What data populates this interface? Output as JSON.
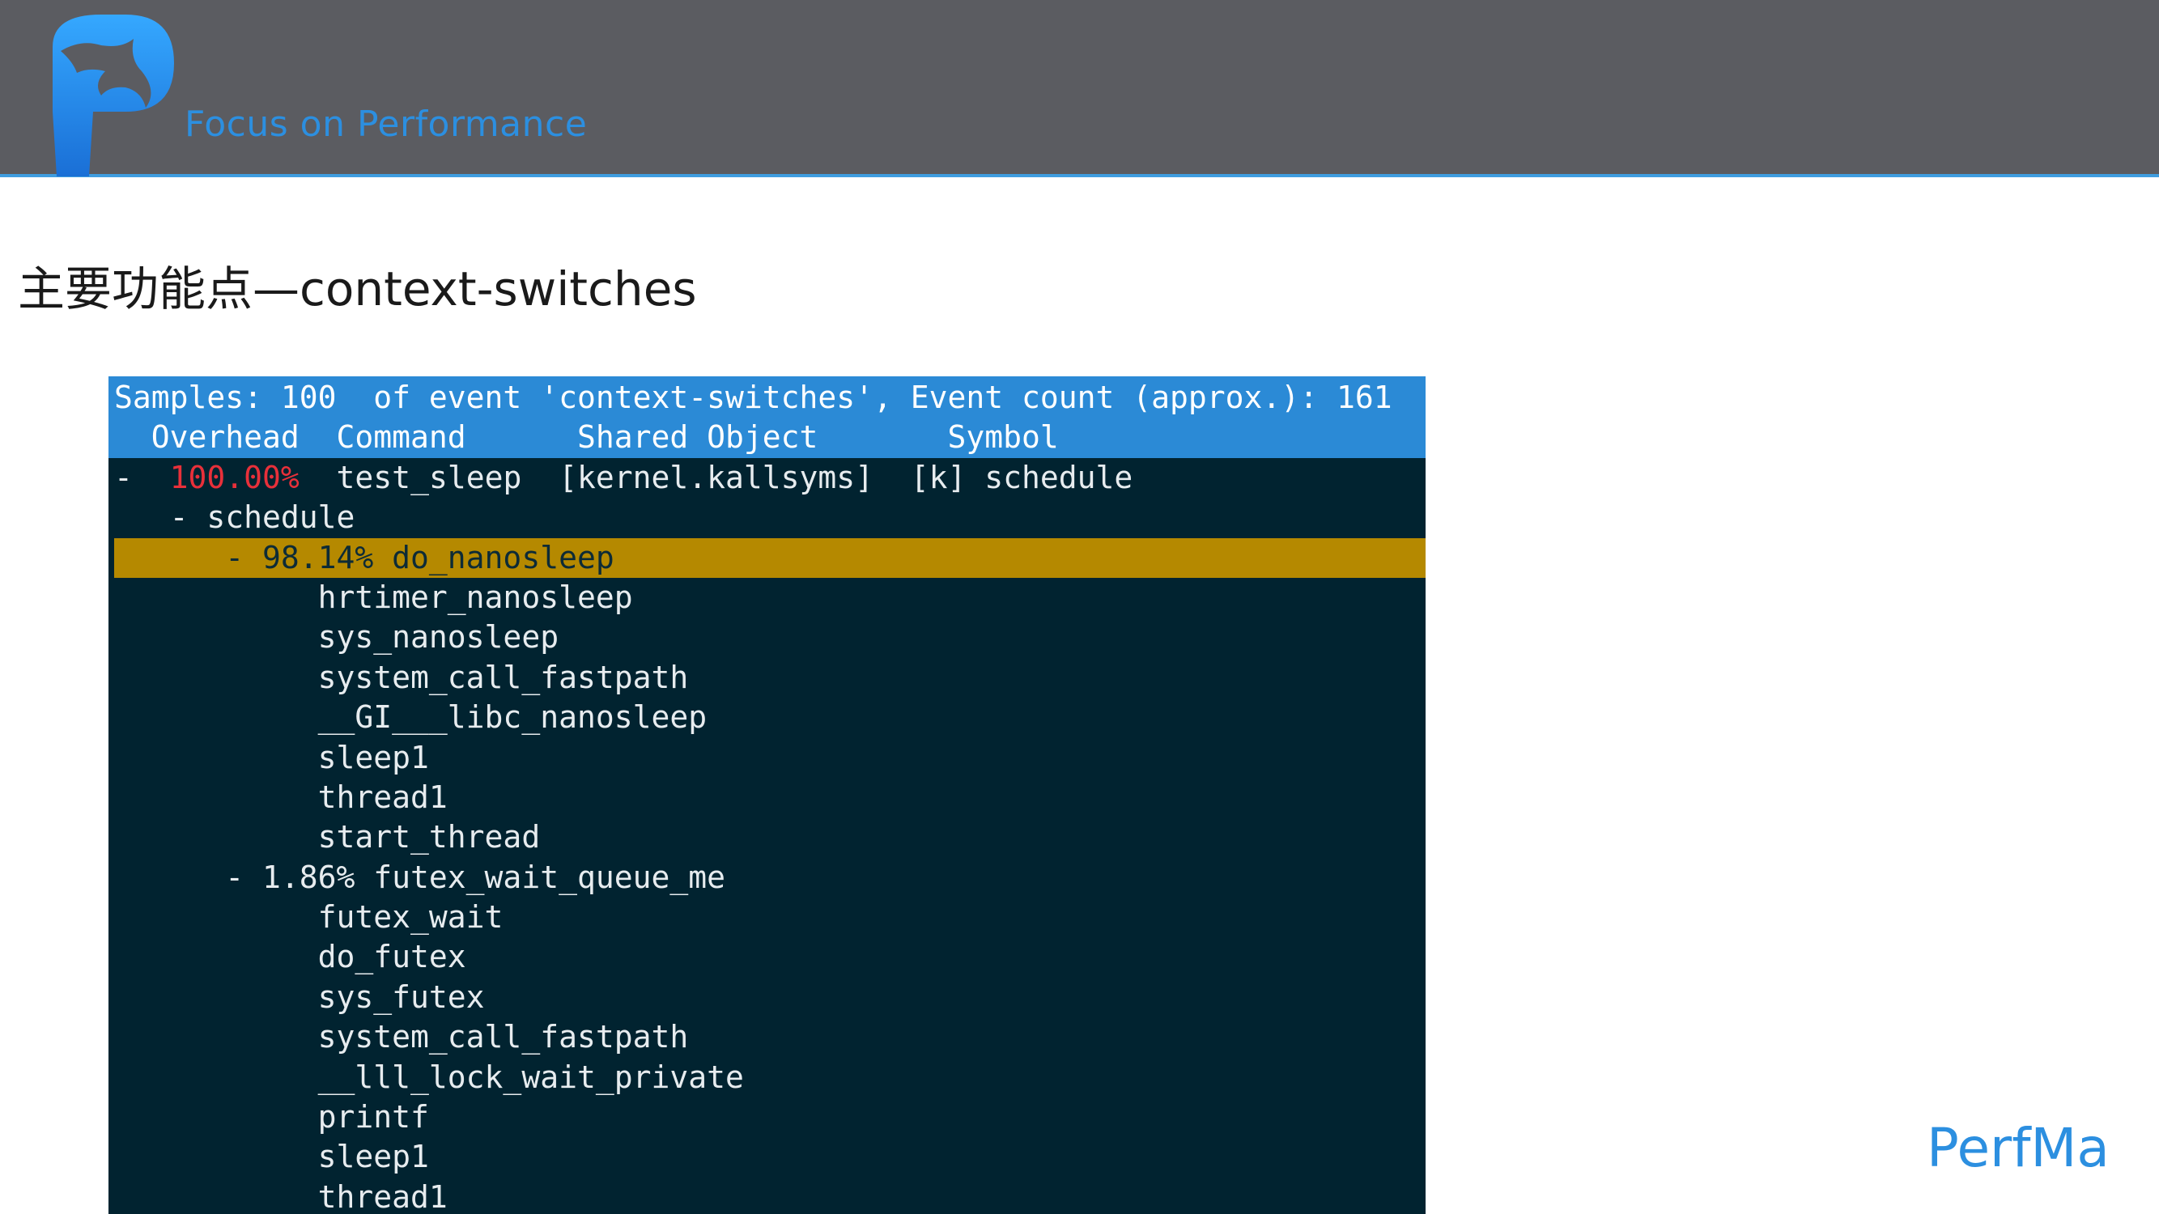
{
  "header": {
    "tagline": "Focus on Performance",
    "logo_icon": "perfma-logo-icon",
    "background_color": "#5b5c61",
    "accent_color": "#3f9ddf"
  },
  "slide": {
    "title": "主要功能点—context-switches"
  },
  "terminal": {
    "header_line": "Samples: 100  of event 'context-switches', Event count (approx.): 161",
    "columns_line": "  Overhead  Command      Shared Object       Symbol",
    "top_entry": {
      "prefix": "-  ",
      "overhead": "100.00%",
      "rest": "  test_sleep  [kernel.kallsyms]  [k] schedule"
    },
    "lines": [
      "   - schedule",
      "      - 98.14% do_nanosleep",
      "           hrtimer_nanosleep",
      "           sys_nanosleep",
      "           system_call_fastpath",
      "           __GI___libc_nanosleep",
      "           sleep1",
      "           thread1",
      "           start_thread",
      "      - 1.86% futex_wait_queue_me",
      "           futex_wait",
      "           do_futex",
      "           sys_futex",
      "           system_call_fastpath",
      "           __lll_lock_wait_private",
      "           printf",
      "           sleep1",
      "           thread1"
    ],
    "colors": {
      "background": "#012330",
      "header": "#2b8ad6",
      "highlight": "#b58900",
      "overhead_red": "#e8303a"
    }
  },
  "footer": {
    "brand": "PerfMa"
  }
}
